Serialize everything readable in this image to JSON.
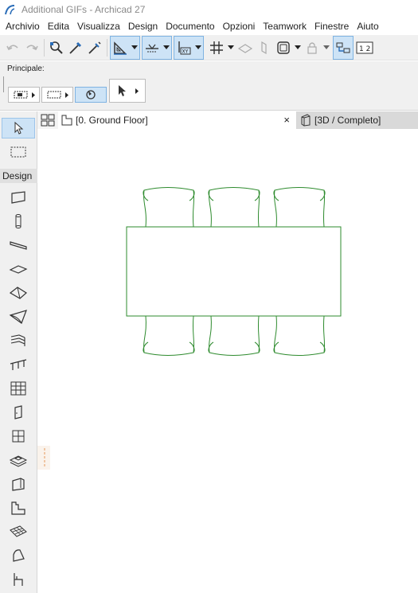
{
  "window": {
    "title": "Additional GIFs - Archicad 27"
  },
  "menu": [
    "Archivio",
    "Edita",
    "Visualizza",
    "Design",
    "Documento",
    "Opzioni",
    "Teamwork",
    "Finestre",
    "Aiuto"
  ],
  "infobox": {
    "label": "Principale:"
  },
  "toolbox": {
    "section_title": "Design"
  },
  "tabs": {
    "floorplan": "[0. Ground Floor]",
    "close_glyph": "×",
    "view3d": "[3D / Completo]"
  },
  "toolbar": {
    "story_label": "1 2"
  },
  "colors": {
    "accent": "#cde3f6",
    "drawing": "#2e8b2e",
    "toolbar_bg": "#f0f0f0"
  },
  "drawing": {
    "elements": [
      "table",
      "chair",
      "chair",
      "chair",
      "chair",
      "chair",
      "chair"
    ]
  }
}
